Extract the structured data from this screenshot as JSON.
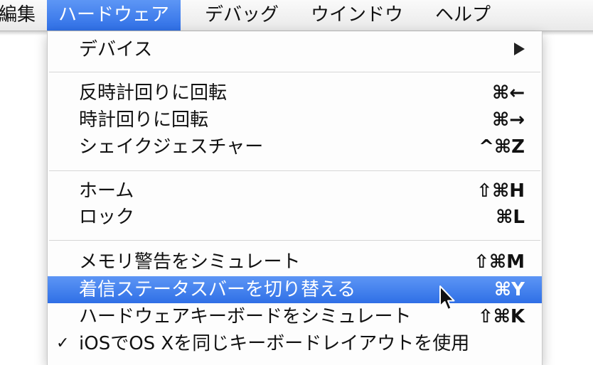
{
  "menubar": {
    "items": [
      {
        "label": "編集"
      },
      {
        "label": "ハードウェア"
      },
      {
        "label": "デバッグ"
      },
      {
        "label": "ウインドウ"
      },
      {
        "label": "ヘルプ"
      }
    ],
    "active_item": "ハードウェア"
  },
  "menu": {
    "items": [
      {
        "label": "デバイス",
        "has_submenu": true
      },
      {
        "label": "反時計回りに回転",
        "shortcut": "⌘←"
      },
      {
        "label": "時計回りに回転",
        "shortcut": "⌘→"
      },
      {
        "label": "シェイクジェスチャー",
        "shortcut": "^⌘Z"
      },
      {
        "label": "ホーム",
        "shortcut": "⇧⌘H"
      },
      {
        "label": "ロック",
        "shortcut": "⌘L"
      },
      {
        "label": "メモリ警告をシミュレート",
        "shortcut": "⇧⌘M"
      },
      {
        "label": "着信ステータスバーを切り替える",
        "shortcut": "⌘Y",
        "highlighted": true
      },
      {
        "label": "ハードウェアキーボードをシミュレート",
        "shortcut": "⇧⌘K"
      },
      {
        "label": "iOSでOS Xを同じキーボードレイアウトを使用",
        "checked": true,
        "checkmark": "✓"
      }
    ]
  },
  "colors": {
    "highlight": "#3a7cf0",
    "menu_background": "#fdfdfd",
    "separator": "#d6d6d6"
  }
}
